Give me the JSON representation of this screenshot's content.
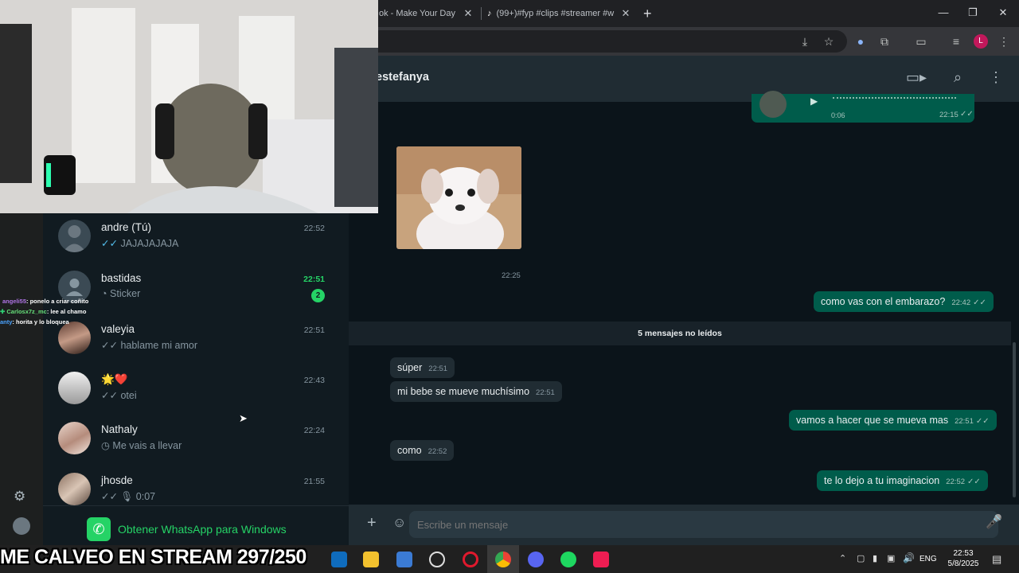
{
  "browser": {
    "tabs": [
      {
        "label": "ok - Make Your Day"
      },
      {
        "label": "(99+)#fyp #clips #streamer #w"
      }
    ],
    "new_tab": "+",
    "window_controls": {
      "minimize": "—",
      "restore": "❐",
      "close": "✕"
    },
    "profile_initial": "L"
  },
  "chat_header": {
    "contact_name": "estefanya"
  },
  "chats": [
    {
      "name": "andre (Tú)",
      "preview": "JAJAJAJAJA",
      "ticks": "✓✓",
      "time": "22:52",
      "unread": ""
    },
    {
      "name": "bastidas",
      "preview": "Sticker",
      "ticks": "",
      "time": "22:51",
      "unread": "2"
    },
    {
      "name": "valeyia",
      "preview": "hablame mi amor",
      "ticks": "✓✓",
      "time": "22:51",
      "unread": ""
    },
    {
      "name": "🌟❤️",
      "preview": "otei",
      "ticks": "✓✓",
      "time": "22:43",
      "unread": ""
    },
    {
      "name": "Nathaly",
      "preview": "Me vais a llevar",
      "ticks": "",
      "time": "22:24",
      "unread": ""
    },
    {
      "name": "jhosde",
      "preview": "0:07",
      "ticks": "✓✓",
      "time": "21:55",
      "unread": ""
    }
  ],
  "get_app": "Obtener WhatsApp para Windows",
  "stream_chat": [
    {
      "user": "angeli55",
      "text": ": ponelo a criar coñito"
    },
    {
      "user": "Carlosx7z_mc",
      "text": ": lee al chamo"
    },
    {
      "user": "anty",
      "text": ": horita y lo bloquea"
    }
  ],
  "messages": {
    "voice_duration": "0:06",
    "voice_time": "22:15",
    "sticker_time": "22:25",
    "m1": {
      "text": "como vas con el embarazo?",
      "time": "22:42"
    },
    "unread_divider": "5 mensajes no leídos",
    "m2": {
      "text": "súper",
      "time": "22:51"
    },
    "m3": {
      "text": "mi bebe se mueve muchísimo",
      "time": "22:51"
    },
    "m4": {
      "text": "vamos a hacer que se mueva mas",
      "time": "22:51"
    },
    "m5": {
      "text": "como",
      "time": "22:52"
    },
    "m6": {
      "text": "te lo dejo a tu imaginacion",
      "time": "22:52"
    }
  },
  "composer": {
    "placeholder": "Escribe un mensaje"
  },
  "overlay_text": "ME CALVEO EN STREAM 297/250",
  "taskbar": {
    "language": "ENG",
    "time": "22:53",
    "date": "5/8/2025"
  },
  "colors": {
    "whatsapp_green": "#25d366",
    "outgoing_bubble": "#005c4b"
  }
}
